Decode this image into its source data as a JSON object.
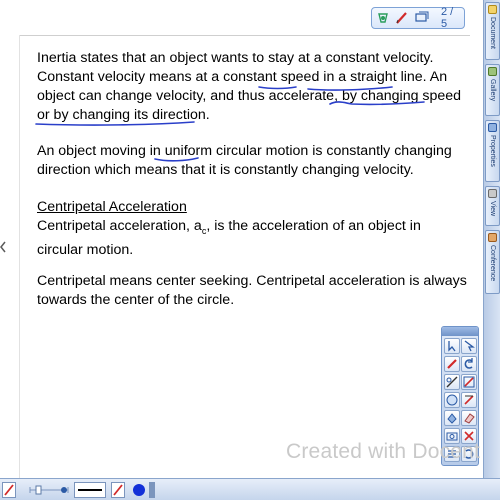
{
  "toolbar": {
    "page_indicator": "2 / 5"
  },
  "content": {
    "p1": {
      "s1": "Inertia states that an object wants to stay at a constant velocity. Constant velocity means at a constant ",
      "speed": "speed",
      "s2": " in a ",
      "straight_line": "straight line",
      "s3": ".  An object can change velocity, and thus accelerate, by ",
      "changing_speed": "changing speed",
      "s4": " ",
      "or_direction": "or by changing its direction",
      "s5": "."
    },
    "p2": {
      "s1": "An object moving in ",
      "uniform": "uniform",
      "s2": " circular motion is constantly changing direction which means that it is constantly changing velocity."
    },
    "p3": {
      "heading": "Centripetal Acceleration",
      "s1": "Centripetal acceleration, a",
      "sub": "c",
      "s2": ", is the acceleration of an object in circular motion."
    },
    "p4": "Centripetal means center seeking.  Centripetal acceleration is always towards the center of the circle."
  },
  "sidebar": {
    "tabs": [
      "Document",
      "Gallery",
      "Properties",
      "View",
      "Conference"
    ]
  },
  "watermark": "Created with Docent",
  "colors": {
    "ink": "#2a3fc9",
    "accent": "#6f93c8",
    "sidebar": "#c8d8ef"
  },
  "icons": [
    "undo-icon",
    "pen-icon",
    "eraser-icon",
    "select-arrow-icon",
    "shape-icon",
    "line-icon",
    "highlighter-icon",
    "fill-icon",
    "text-icon",
    "delete-icon",
    "camera-icon",
    "redo-icon"
  ]
}
